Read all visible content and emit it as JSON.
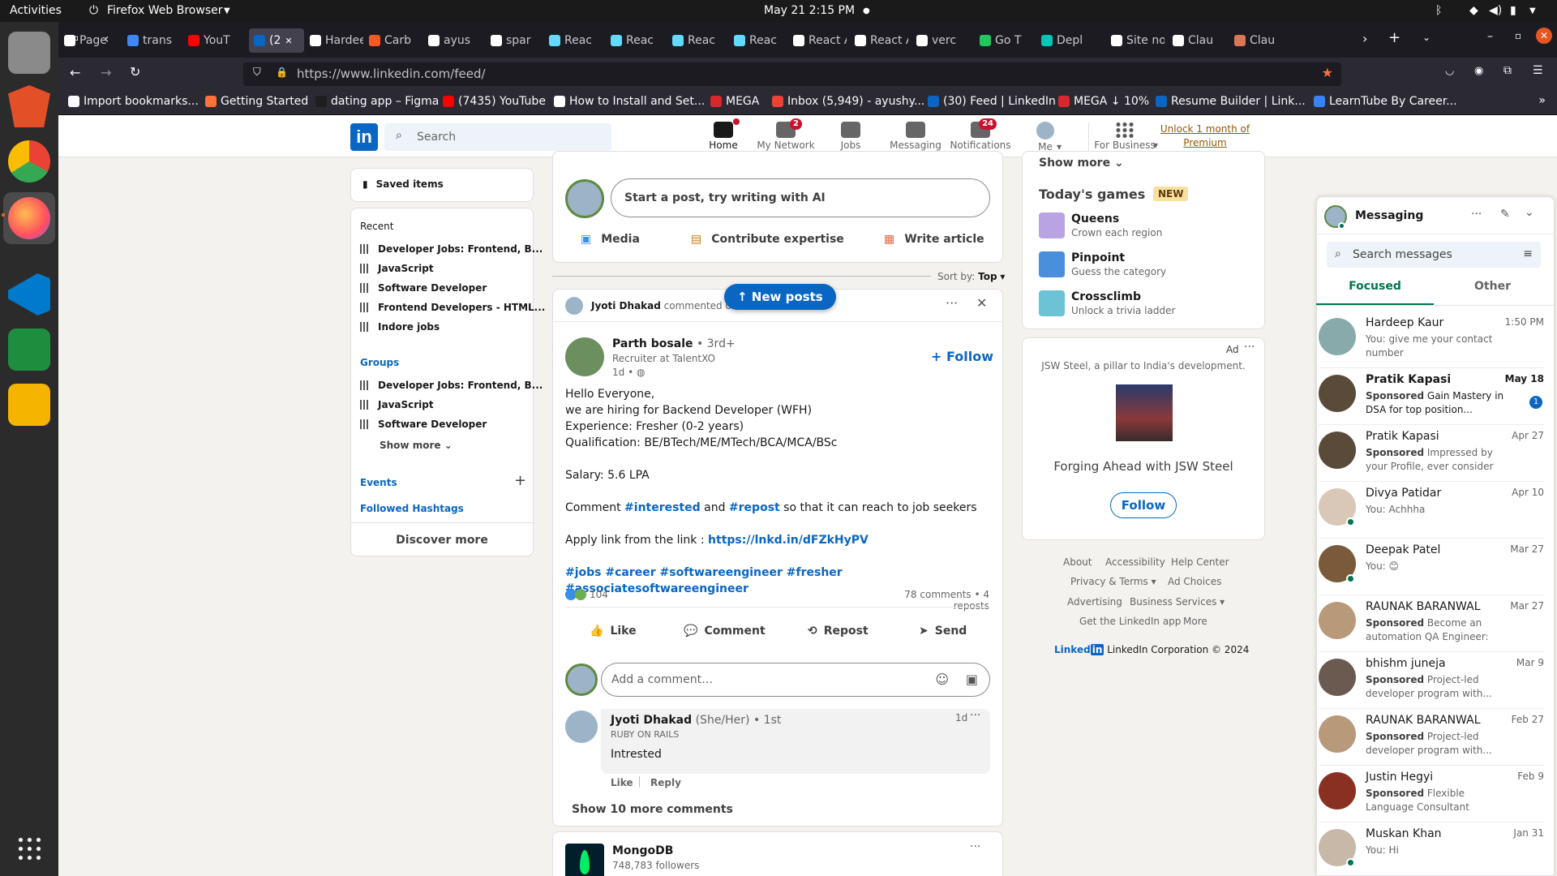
{
  "system": {
    "activities": "Activities",
    "app_menu": "Firefox Web Browser",
    "clock": "May 21  2:15 PM"
  },
  "tabs": [
    {
      "label": "Page",
      "color": "#ffffff"
    },
    {
      "label": "trans",
      "color": "#4285f4"
    },
    {
      "label": "YouT",
      "color": "#ff0000"
    },
    {
      "label": "(2",
      "color": "#0a66c2"
    },
    {
      "label": "Hardee",
      "color": "#ffffff"
    },
    {
      "label": "Carb",
      "color": "#ff5722"
    },
    {
      "label": "ayus",
      "color": "#ffffff"
    },
    {
      "label": "spar",
      "color": "#ffffff"
    },
    {
      "label": "Reac",
      "color": "#61dafb"
    },
    {
      "label": "Reac",
      "color": "#61dafb"
    },
    {
      "label": "Reac",
      "color": "#61dafb"
    },
    {
      "label": "Reac",
      "color": "#61dafb"
    },
    {
      "label": "React A",
      "color": "#ffffff"
    },
    {
      "label": "React A",
      "color": "#ffffff"
    },
    {
      "label": "verc",
      "color": "#ffffff"
    },
    {
      "label": "Go T",
      "color": "#22c55e"
    },
    {
      "label": "Depl",
      "color": "#00c7b7"
    },
    {
      "label": "Site not",
      "color": "#ffffff"
    },
    {
      "label": "Clau",
      "color": "#ffffff"
    },
    {
      "label": "Clau",
      "color": "#d97757"
    }
  ],
  "url": "https://www.linkedin.com/feed/",
  "bookmarks": [
    {
      "label": "Import bookmarks...",
      "color": "#fbfbfe"
    },
    {
      "label": "Getting Started",
      "color": "#ff7139"
    },
    {
      "label": "dating app – Figma",
      "color": "#1e1e1e"
    },
    {
      "label": "(7435) YouTube",
      "color": "#ff0000"
    },
    {
      "label": "How to Install and Set...",
      "color": "#ffffff"
    },
    {
      "label": "MEGA",
      "color": "#d9272e"
    },
    {
      "label": "Inbox (5,949) - ayushy...",
      "color": "#ea4335"
    },
    {
      "label": "(30) Feed | LinkedIn",
      "color": "#0a66c2"
    },
    {
      "label": "MEGA ↓ 10%",
      "color": "#d9272e"
    },
    {
      "label": "Resume Builder | Link...",
      "color": "#0a66c2"
    },
    {
      "label": "LearnTube By Career...",
      "color": "#3b82f6"
    }
  ],
  "linkedin": {
    "logo": "in",
    "search_placeholder": "Search",
    "nav": [
      {
        "label": "Home",
        "badge": ""
      },
      {
        "label": "My Network",
        "badge": "2"
      },
      {
        "label": "Jobs",
        "badge": ""
      },
      {
        "label": "Messaging",
        "badge": ""
      },
      {
        "label": "Notifications",
        "badge": "24"
      },
      {
        "label": "Me",
        "badge": ""
      },
      {
        "label": "For Business",
        "badge": ""
      }
    ],
    "premium": "Unlock 1 month of Premium",
    "left": {
      "saved": "Saved items",
      "recent_title": "Recent",
      "recent": [
        "Developer Jobs: Frontend, B...",
        "JavaScript",
        "Software Developer",
        "Frontend Developers - HTML...",
        "Indore jobs"
      ],
      "groups_title": "Groups",
      "groups": [
        "Developer Jobs: Frontend, B...",
        "JavaScript",
        "Software Developer"
      ],
      "show_more": "Show more",
      "events": "Events",
      "hashtags": "Followed Hashtags",
      "discover": "Discover more"
    },
    "composer": {
      "placeholder": "Start a post, try writing with AI",
      "media": "Media",
      "expertise": "Contribute expertise",
      "article": "Write article"
    },
    "sort": {
      "label": "Sort by:",
      "value": "Top"
    },
    "new_posts": "New posts",
    "post": {
      "context_name": "Jyoti Dhakad",
      "context_action": "commented on this",
      "author": "Parth bosale",
      "degree": "• 3rd+",
      "headline": "Recruiter at TalentXO",
      "time": "1d •",
      "follow": "Follow",
      "lines": [
        "Hello Everyone,",
        "we are hiring for Backend Developer (WFH)",
        "Experience: Fresher (0-2 years)",
        "Qualification: BE/BTech/ME/MTech/BCA/MCA/BSc"
      ],
      "salary": "Salary: 5.6 LPA",
      "comment_pre": "Comment",
      "tag1": "#interested",
      "comment_mid": "and",
      "tag2": "#repost",
      "comment_post": "so that it can reach to job seekers",
      "apply_pre": "Apply link from the link :",
      "apply_link": "https://lnkd.in/dFZkHyPV",
      "hashtags": "#jobs #career #softwareengineer #fresher #associatesoftwareengineer",
      "reactions": "104",
      "stats": "78 comments • 4 reposts",
      "actions": [
        "Like",
        "Comment",
        "Repost",
        "Send"
      ],
      "add_comment": "Add a comment…",
      "comment": {
        "name": "Jyoti Dhakad",
        "pronoun": "(She/Her) • 1st",
        "headline": "RUBY ON RAILS",
        "time": "1d",
        "text": "Intrested",
        "like": "Like",
        "reply": "Reply"
      },
      "more_comments": "Show 10 more comments"
    },
    "next_post": {
      "author": "MongoDB",
      "followers": "748,783 followers"
    },
    "right": {
      "show_more": "Show more",
      "games_title": "Today's games",
      "games_badge": "NEW",
      "games": [
        {
          "name": "Queens",
          "desc": "Crown each region",
          "color": "#b9a3e3"
        },
        {
          "name": "Pinpoint",
          "desc": "Guess the category",
          "color": "#4a8fdb"
        },
        {
          "name": "Crossclimb",
          "desc": "Unlock a trivia ladder",
          "color": "#6cc3d5"
        }
      ],
      "ad_label": "Ad",
      "ad_text": "JSW Steel, a pillar to India's development.",
      "ad_title": "Forging Ahead with JSW Steel",
      "ad_follow": "Follow",
      "footer": [
        "About",
        "Accessibility",
        "Help Center",
        "Privacy & Terms",
        "Ad Choices",
        "Advertising",
        "Business Services",
        "Get the LinkedIn app",
        "More"
      ],
      "copyright": "LinkedIn Corporation © 2024",
      "brand": "Linked"
    },
    "messaging": {
      "title": "Messaging",
      "search": "Search messages",
      "tabs": [
        "Focused",
        "Other"
      ],
      "rows": [
        {
          "name": "Hardeep Kaur",
          "date": "1:50 PM",
          "sponsored": "",
          "preview": "You: give me your contact number",
          "bold": false,
          "color": "#8aa"
        },
        {
          "name": "Pratik Kapasi",
          "date": "May 18",
          "sponsored": "Sponsored",
          "preview": "Gain Mastery in DSA for top position...",
          "bold": true,
          "color": "#5a4a3a"
        },
        {
          "name": "Pratik Kapasi",
          "date": "Apr 27",
          "sponsored": "Sponsored",
          "preview": "Impressed by your Profile, ever consider working a...",
          "bold": false,
          "color": "#5a4a3a"
        },
        {
          "name": "Divya Patidar",
          "date": "Apr 10",
          "sponsored": "",
          "preview": "You: Achhha",
          "bold": false,
          "color": "#d9c7b8"
        },
        {
          "name": "Deepak Patel",
          "date": "Mar 27",
          "sponsored": "",
          "preview": "You: 😊",
          "bold": false,
          "color": "#7a5a3a"
        },
        {
          "name": "RAUNAK BARANWAL",
          "date": "Mar 27",
          "sponsored": "Sponsored",
          "preview": "Become an automation QA Engineer: Seize...",
          "bold": false,
          "color": "#b89a7a"
        },
        {
          "name": "bhishm juneja",
          "date": "Mar 9",
          "sponsored": "Sponsored",
          "preview": "Project-led developer program with...",
          "bold": false,
          "color": "#6a5a50"
        },
        {
          "name": "RAUNAK BARANWAL",
          "date": "Feb 27",
          "sponsored": "Sponsored",
          "preview": "Project-led developer program with...",
          "bold": false,
          "color": "#b89a7a"
        },
        {
          "name": "Justin Hegyi",
          "date": "Feb 9",
          "sponsored": "Sponsored",
          "preview": "Flexible Language Consultant Opportunity",
          "bold": false,
          "color": "#8a3020"
        },
        {
          "name": "Muskan Khan",
          "date": "Jan 31",
          "sponsored": "",
          "preview": "You: Hi",
          "bold": false,
          "color": "#c8b8a8"
        }
      ],
      "unread": "1"
    }
  }
}
